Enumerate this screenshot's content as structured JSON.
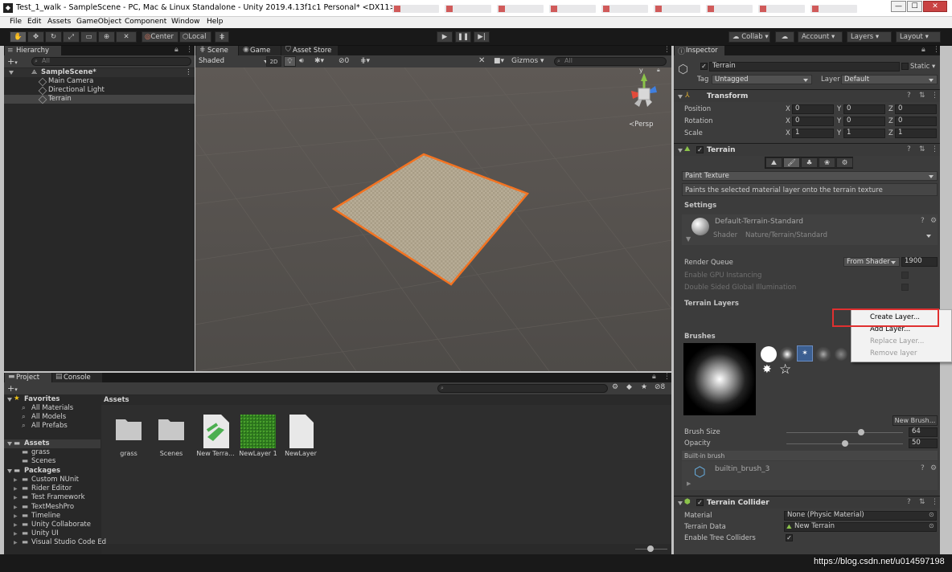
{
  "window": {
    "app_icon": "unity-icon",
    "title": "Test_1_walk - SampleScene - PC, Mac & Linux Standalone - Unity 2019.4.13f1c1 Personal* <DX11>",
    "min": "—",
    "max": "☐",
    "close": "✕"
  },
  "menu": [
    "File",
    "Edit",
    "Assets",
    "GameObject",
    "Component",
    "Window",
    "Help"
  ],
  "toolbar": {
    "center": "Center",
    "local": "Local",
    "collab": "Collab",
    "account": "Account",
    "layers": "Layers",
    "layout": "Layout"
  },
  "hierarchy": {
    "tab": "Hierarchy",
    "search_placeholder": "All",
    "add": "+",
    "scene": "SampleScene*",
    "items": [
      "Main Camera",
      "Directional Light",
      "Terrain"
    ]
  },
  "scene_view": {
    "tabs": [
      "Scene",
      "Game",
      "Asset Store"
    ],
    "shading": "Shaded",
    "mode2d": "2D",
    "fx_count": "0",
    "gizmos": "Gizmos",
    "search_placeholder": "All",
    "persp": "Persp",
    "gizmo_axes": {
      "y": "y",
      "x": "x",
      "z": "z"
    }
  },
  "project": {
    "tabs": [
      "Project",
      "Console"
    ],
    "add": "+",
    "favorites_title": "Favorites",
    "favorites": [
      "All Materials",
      "All Models",
      "All Prefabs"
    ],
    "assets_title": "Assets",
    "asset_folders": [
      "grass",
      "Scenes"
    ],
    "packages_title": "Packages",
    "packages": [
      "Custom NUnit",
      "Rider Editor",
      "Test Framework",
      "TextMeshPro",
      "Timeline",
      "Unity Collaborate",
      "Unity UI",
      "Visual Studio Code Ed"
    ],
    "breadcrumb": "Assets",
    "hidden_count": "8",
    "items": [
      {
        "name": "grass",
        "kind": "folder"
      },
      {
        "name": "Scenes",
        "kind": "folder"
      },
      {
        "name": "New Terra...",
        "kind": "terrain"
      },
      {
        "name": "NewLayer 1",
        "kind": "grass"
      },
      {
        "name": "NewLayer",
        "kind": "file"
      }
    ]
  },
  "inspector": {
    "tab": "Inspector",
    "object_name": "Terrain",
    "static_label": "Static",
    "tag_label": "Tag",
    "tag_value": "Untagged",
    "layer_label": "Layer",
    "layer_value": "Default",
    "transform": {
      "title": "Transform",
      "rows": [
        {
          "label": "Position",
          "x": "0",
          "y": "0",
          "z": "0"
        },
        {
          "label": "Rotation",
          "x": "0",
          "y": "0",
          "z": "0"
        },
        {
          "label": "Scale",
          "x": "1",
          "y": "1",
          "z": "1"
        }
      ],
      "axis_x": "X",
      "axis_y": "Y",
      "axis_z": "Z"
    },
    "terrain": {
      "title": "Terrain",
      "tool_dropdown": "Paint Texture",
      "tool_description": "Paints the selected material layer onto the terrain texture",
      "settings_label": "Settings",
      "material_name": "Default-Terrain-Standard",
      "shader_label": "Shader",
      "shader_value": "Nature/Terrain/Standard",
      "render_queue_label": "Render Queue",
      "render_queue_mode": "From Shader",
      "render_queue_value": "1900",
      "gpu_instancing": "Enable GPU Instancing",
      "double_sided": "Double Sided Global Illumination",
      "terrain_layers_label": "Terrain Layers",
      "brushes_label": "Brushes",
      "new_brush": "New Brush...",
      "brush_size_label": "Brush Size",
      "brush_size_value": "64",
      "brush_size": 64,
      "brush_size_max": 100,
      "opacity_label": "Opacity",
      "opacity_value": "50",
      "opacity": 50,
      "opacity_max": 100,
      "builtin_brush_header": "Built-in brush",
      "builtin_brush_name": "builtin_brush_3"
    },
    "collider": {
      "title": "Terrain Collider",
      "material_label": "Material",
      "material_value": "None (Physic Material)",
      "data_label": "Terrain Data",
      "data_value": "New Terrain",
      "trees_label": "Enable Tree Colliders"
    }
  },
  "context_menu": {
    "items": [
      {
        "label": "Create Layer...",
        "enabled": true,
        "highlighted": true
      },
      {
        "label": "Add Layer...",
        "enabled": true
      },
      {
        "label": "Replace Layer...",
        "enabled": false
      },
      {
        "label": "Remove layer",
        "enabled": false
      }
    ]
  },
  "watermark": "https://blog.csdn.net/u014597198",
  "colors": {
    "selection_outline": "#f37321",
    "highlight_box": "#e03030",
    "accent": "#3c5f91"
  }
}
